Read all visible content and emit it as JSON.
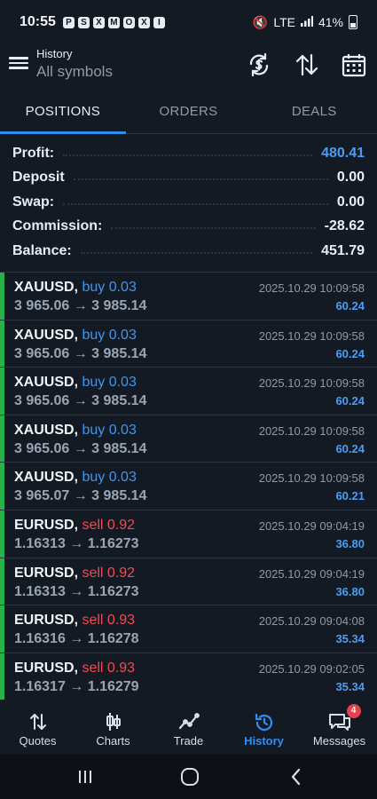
{
  "status_bar": {
    "time": "10:55",
    "notification_icons": [
      "P",
      "S",
      "X",
      "M",
      "O",
      "X",
      "I"
    ],
    "network": "LTE",
    "battery": "41%"
  },
  "app_bar": {
    "title": "History",
    "subtitle": "All symbols",
    "icons": [
      "menu-icon",
      "currency-refresh-icon",
      "sort-icon",
      "calendar-icon"
    ]
  },
  "tabs": [
    {
      "label": "POSITIONS",
      "active": true
    },
    {
      "label": "ORDERS",
      "active": false
    },
    {
      "label": "DEALS",
      "active": false
    }
  ],
  "summary": [
    {
      "label": "Profit:",
      "value": "480.41",
      "color": "#4a9df4"
    },
    {
      "label": "Deposit",
      "value": "0.00",
      "color": "#e8edf3"
    },
    {
      "label": "Swap:",
      "value": "0.00",
      "color": "#e8edf3"
    },
    {
      "label": "Commission:",
      "value": "-28.62",
      "color": "#e8edf3"
    },
    {
      "label": "Balance:",
      "value": "451.79",
      "color": "#e8edf3"
    }
  ],
  "trades": [
    {
      "symbol": "XAUUSD,",
      "side": "buy 0.03",
      "direction": "buy",
      "prices": "3 965.06 → 3 985.14",
      "time": "2025.10.29 10:09:58",
      "profit": "60.24"
    },
    {
      "symbol": "XAUUSD,",
      "side": "buy 0.03",
      "direction": "buy",
      "prices": "3 965.06 → 3 985.14",
      "time": "2025.10.29 10:09:58",
      "profit": "60.24"
    },
    {
      "symbol": "XAUUSD,",
      "side": "buy 0.03",
      "direction": "buy",
      "prices": "3 965.06 → 3 985.14",
      "time": "2025.10.29 10:09:58",
      "profit": "60.24"
    },
    {
      "symbol": "XAUUSD,",
      "side": "buy 0.03",
      "direction": "buy",
      "prices": "3 965.06 → 3 985.14",
      "time": "2025.10.29 10:09:58",
      "profit": "60.24"
    },
    {
      "symbol": "XAUUSD,",
      "side": "buy 0.03",
      "direction": "buy",
      "prices": "3 965.07 → 3 985.14",
      "time": "2025.10.29 10:09:58",
      "profit": "60.21"
    },
    {
      "symbol": "EURUSD,",
      "side": "sell 0.92",
      "direction": "sell",
      "prices": "1.16313 → 1.16273",
      "time": "2025.10.29 09:04:19",
      "profit": "36.80"
    },
    {
      "symbol": "EURUSD,",
      "side": "sell 0.92",
      "direction": "sell",
      "prices": "1.16313 → 1.16273",
      "time": "2025.10.29 09:04:19",
      "profit": "36.80"
    },
    {
      "symbol": "EURUSD,",
      "side": "sell 0.93",
      "direction": "sell",
      "prices": "1.16316 → 1.16278",
      "time": "2025.10.29 09:04:08",
      "profit": "35.34"
    },
    {
      "symbol": "EURUSD,",
      "side": "sell 0.93",
      "direction": "sell",
      "prices": "1.16317 → 1.16279",
      "time": "2025.10.29 09:02:05",
      "profit": "35.34"
    }
  ],
  "bottom_nav": [
    {
      "label": "Quotes",
      "icon": "quotes-icon",
      "active": false
    },
    {
      "label": "Charts",
      "icon": "charts-icon",
      "active": false
    },
    {
      "label": "Trade",
      "icon": "trade-icon",
      "active": false
    },
    {
      "label": "History",
      "icon": "history-icon",
      "active": true
    },
    {
      "label": "Messages",
      "icon": "messages-icon",
      "active": false,
      "badge": "4"
    }
  ],
  "colors": {
    "accent": "#2f8ff0",
    "buy": "#3f95f0",
    "sell": "#f04a55",
    "profit": "#4a9df4",
    "position_edge": "#27b14a",
    "background": "#131a23"
  }
}
